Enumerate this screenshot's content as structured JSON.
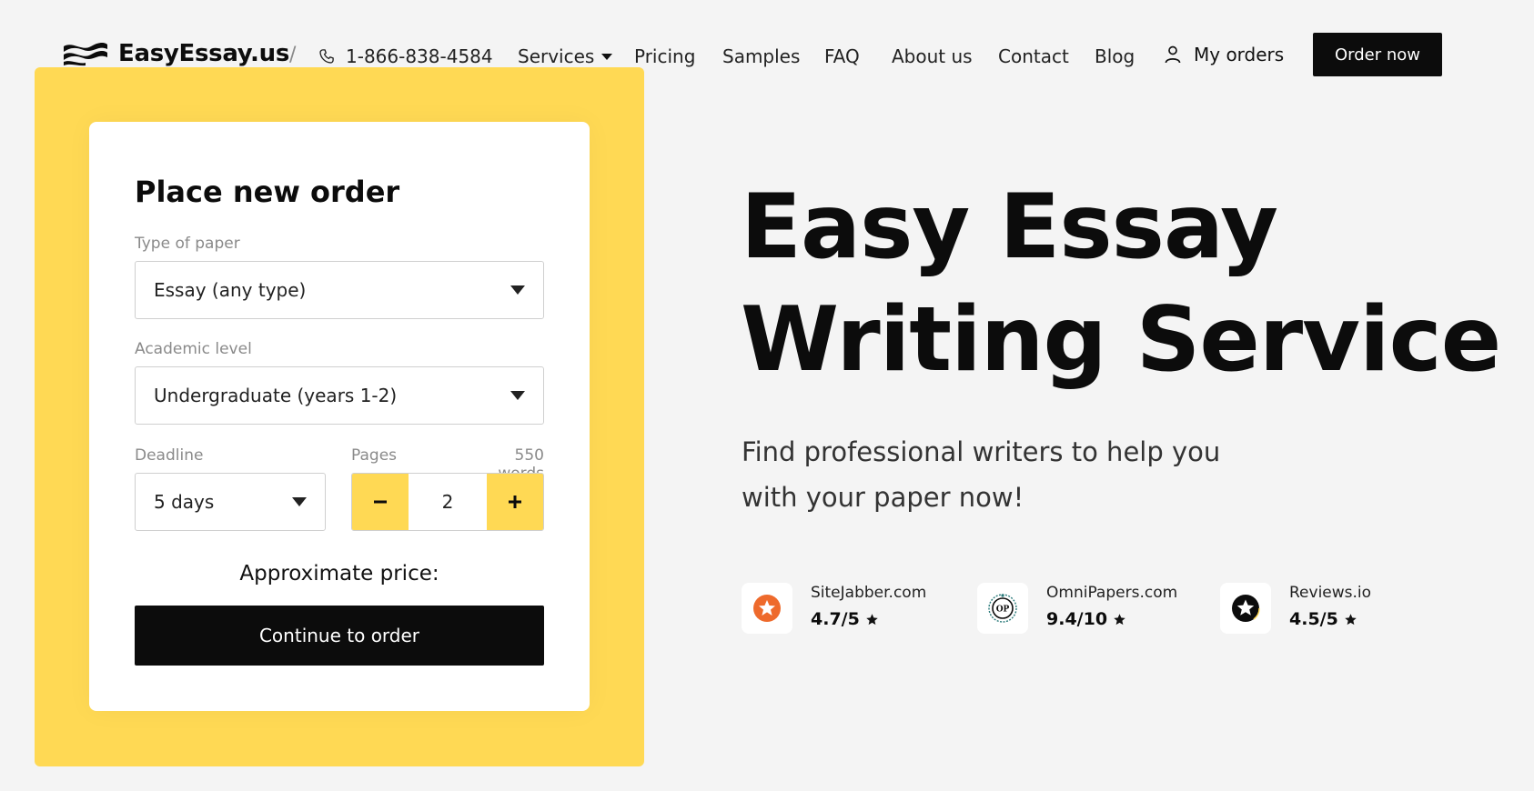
{
  "header": {
    "logo_text": "EasyEssay.us",
    "divider": "/",
    "phone": "1-866-838-4584",
    "nav": [
      {
        "label": "Services"
      },
      {
        "label": "Pricing"
      },
      {
        "label": "Samples"
      },
      {
        "label": "FAQ"
      },
      {
        "label": "About us"
      },
      {
        "label": "Contact"
      },
      {
        "label": "Blog"
      }
    ],
    "my_orders": "My orders",
    "order_now": "Order now"
  },
  "order_form": {
    "title": "Place new order",
    "type_of_paper": {
      "label": "Type of paper",
      "value": "Essay (any type)"
    },
    "academic_level": {
      "label": "Academic level",
      "value": "Undergraduate (years 1-2)"
    },
    "deadline": {
      "label": "Deadline",
      "value": "5 days"
    },
    "pages": {
      "label": "Pages",
      "words": "550 words",
      "value": "2"
    },
    "approx_price_label": "Approximate price:",
    "continue_button": "Continue to order"
  },
  "hero": {
    "title_line1": "Easy Essay",
    "title_line2": "Writing Service",
    "subtitle": "Find professional writers to help you with your paper now!"
  },
  "reviews": [
    {
      "site": "SiteJabber.com",
      "score": "4.7/5",
      "icon": "sitejabber-icon"
    },
    {
      "site": "OmniPapers.com",
      "score": "9.4/10",
      "icon": "omnipapers-icon"
    },
    {
      "site": "Reviews.io",
      "score": "4.5/5",
      "icon": "reviewsio-icon"
    }
  ],
  "colors": {
    "accent_yellow": "#ffd954",
    "dark": "#0c0c0c",
    "background": "#f4f4f4",
    "sitejabber_orange": "#ee6a2c",
    "omnipapers_teal": "#2a7a7a"
  }
}
